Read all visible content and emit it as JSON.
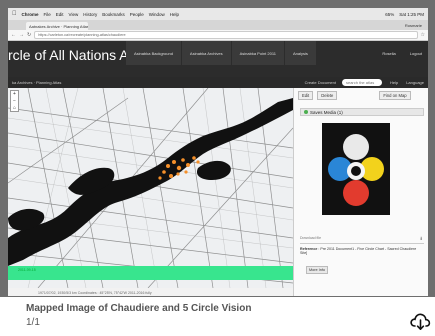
{
  "screenshot": {
    "mac_menubar": {
      "items": [
        "Chrome",
        "File",
        "Edit",
        "View",
        "History",
        "Bookmarks",
        "People",
        "Window",
        "Help"
      ],
      "battery": "65%",
      "clock": "Sat 1:25 PM"
    },
    "browser": {
      "tab_title": "Aatnakes Archive · Planning Atlas",
      "person_label": "Rosmarie",
      "url": "https://carleton.ca/recreate/planning-atlas/chaudiere"
    },
    "site": {
      "title": "rcle of All Nations Atlas",
      "nav": [
        "Asinabka Background",
        "Asinabka Archives",
        "Asinabka Point 2011",
        "Analysis"
      ],
      "links": [
        "Roselia",
        "Logout"
      ]
    },
    "subbar": {
      "breadcrumb": "ka Archives · Planning Atlas",
      "create_document": "Create Document",
      "search_placeholder": "search the atlas",
      "help": "Help",
      "language": "Language"
    },
    "map": {
      "toolbar": [
        "+",
        "−",
        "⌂"
      ],
      "band_label": "2011-09-15",
      "status_text": "1971/07/02, 1930/5/3 km   Coordinates : 45°25'N, 75°42'W   2011-2016 fully"
    },
    "panel": {
      "tabs": [
        "Edit",
        "Delete",
        "Find on Map"
      ],
      "media_header": "Saves Media (1)",
      "download_label": "Download file",
      "reference_label": "Reference",
      "reference_text": ": Pre 2011 Document1 - Five Circle Chart - Sacred Chaudiere Site]",
      "more_info": "More Info"
    },
    "colors": {
      "accent_green": "#38e58e",
      "header_dark": "#2c2c2c"
    }
  },
  "caption": {
    "title": "Mapped Image of Chaudiere and 5 Circle Vision",
    "count": "1/1"
  },
  "actions": {
    "download_icon": "cloud-download-icon"
  }
}
